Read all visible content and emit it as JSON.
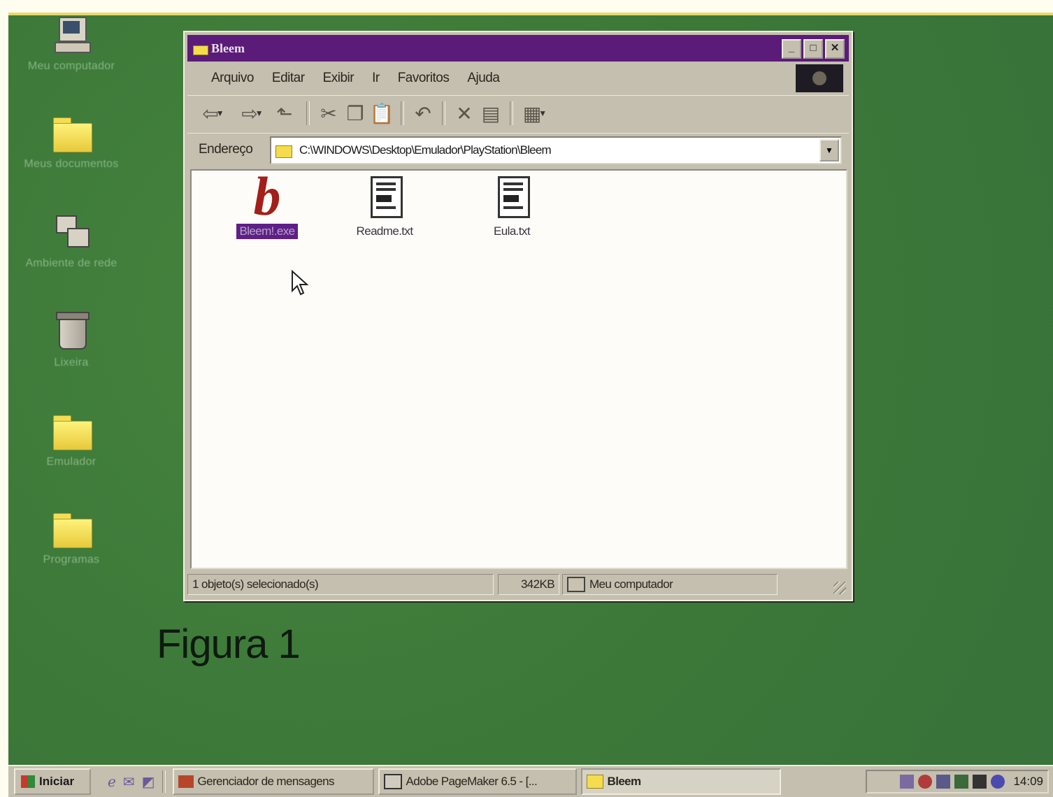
{
  "desktop": {
    "icons": [
      {
        "label": "Meu computador",
        "icon": "my-computer-icon"
      },
      {
        "label": "Meus documentos",
        "icon": "my-documents-icon"
      },
      {
        "label": "Ambiente de rede",
        "icon": "network-neighborhood-icon"
      },
      {
        "label": "Lixeira",
        "icon": "recycle-bin-icon"
      },
      {
        "label": "Emulador",
        "icon": "folder-icon"
      },
      {
        "label": "Programas",
        "icon": "folder-icon"
      }
    ]
  },
  "window": {
    "title": "Bleem",
    "title_buttons": [
      "minimize",
      "maximize",
      "close"
    ],
    "menu": [
      "Arquivo",
      "Editar",
      "Exibir",
      "Ir",
      "Favoritos",
      "Ajuda"
    ],
    "address_label": "Endereço",
    "address_value": "C:\\WINDOWS\\Desktop\\Emulador\\PlayStation\\Bleem",
    "files": [
      {
        "name": "Bleem!.exe",
        "icon": "bleem-app-icon",
        "selected": true
      },
      {
        "name": "Readme.txt",
        "icon": "text-file-icon",
        "selected": false
      },
      {
        "name": "Eula.txt",
        "icon": "text-file-icon",
        "selected": false
      }
    ],
    "status": {
      "selection": "1 objeto(s) selecionado(s)",
      "size": "342KB",
      "zone": "Meu computador"
    }
  },
  "figure_caption": "Figura 1",
  "taskbar": {
    "start_label": "Iniciar",
    "tasks": [
      {
        "label": "Gerenciador de mensagens",
        "active": false
      },
      {
        "label": "Adobe PageMaker 6.5 - [...",
        "active": false
      },
      {
        "label": "Bleem",
        "active": true
      }
    ],
    "clock": "14:09"
  },
  "colors": {
    "desktop": "#3f7c3d",
    "titlebar": "#5a1c78",
    "selection": "#5e1f86",
    "chrome": "#c4bfae"
  }
}
